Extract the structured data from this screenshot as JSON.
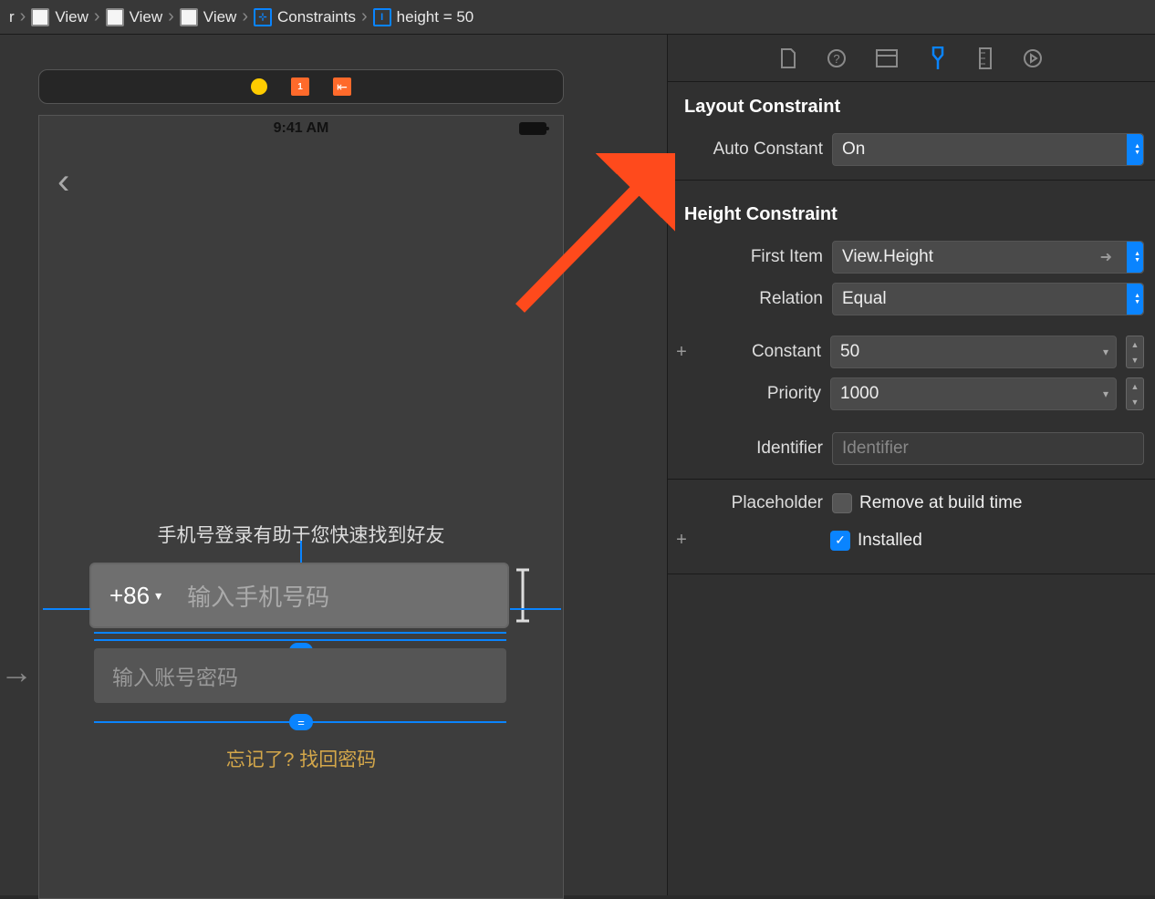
{
  "breadcrumb": [
    {
      "icon": "view",
      "label": "View"
    },
    {
      "icon": "view",
      "label": "View"
    },
    {
      "icon": "view",
      "label": "View"
    },
    {
      "icon": "constraint",
      "label": "Constraints"
    },
    {
      "icon": "constraint",
      "label": "height = 50"
    }
  ],
  "canvas": {
    "statusTime": "9:41 AM",
    "subtitle": "手机号登录有助于您快速找到好友",
    "countryCode": "+86",
    "phonePlaceholder": "输入手机号码",
    "passwordPlaceholder": "输入账号密码",
    "forgotText": "忘记了? 找回密码"
  },
  "inspector": {
    "section1": "Layout Constraint",
    "autoConstantLabel": "Auto Constant",
    "autoConstantValue": "On",
    "section2": "Height Constraint",
    "firstItemLabel": "First Item",
    "firstItemValue": "View.Height",
    "relationLabel": "Relation",
    "relationValue": "Equal",
    "constantLabel": "Constant",
    "constantValue": "50",
    "priorityLabel": "Priority",
    "priorityValue": "1000",
    "identifierLabel": "Identifier",
    "identifierPlaceholder": "Identifier",
    "placeholderLabel": "Placeholder",
    "placeholderCheckLabel": "Remove at build time",
    "installedLabel": "Installed"
  }
}
